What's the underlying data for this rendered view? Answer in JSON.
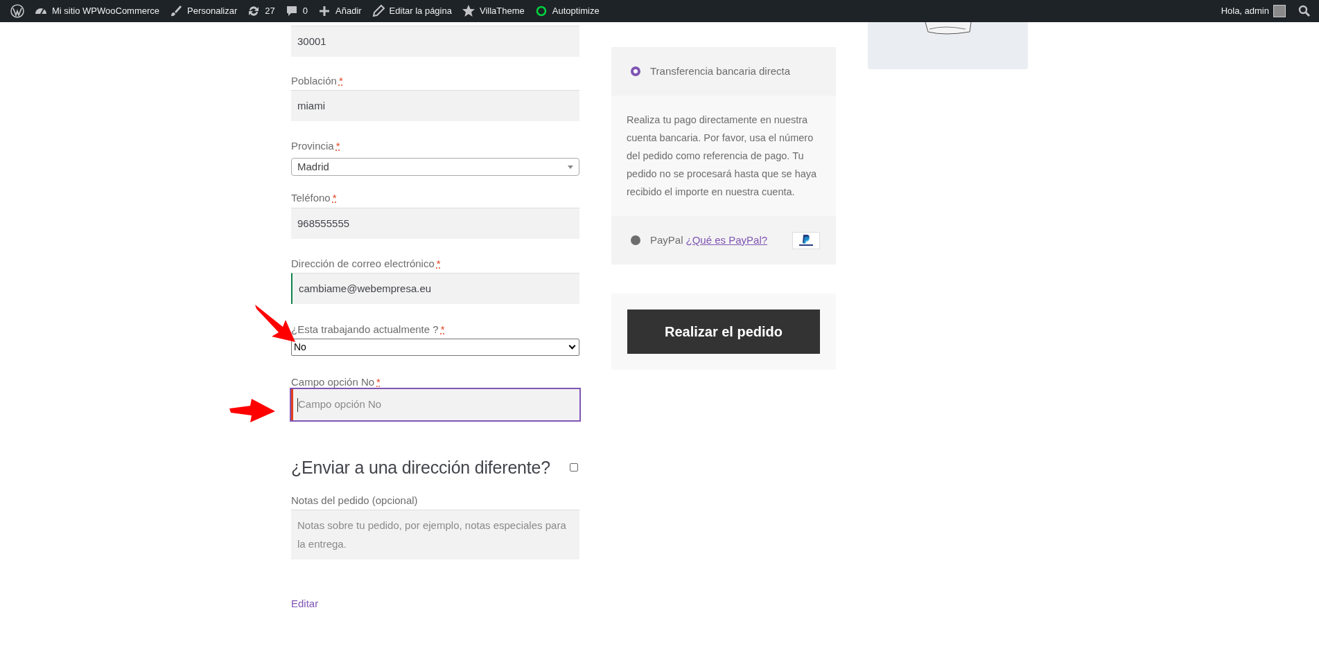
{
  "admin_bar": {
    "items": [
      {
        "kind": "wp"
      },
      {
        "kind": "site",
        "label": "Mi sitio WPWooCommerce"
      },
      {
        "kind": "customize",
        "label": "Personalizar"
      },
      {
        "kind": "updates",
        "label": "27"
      },
      {
        "kind": "comments",
        "label": "0"
      },
      {
        "kind": "new",
        "label": "Añadir"
      },
      {
        "kind": "edit",
        "label": "Editar la página"
      },
      {
        "kind": "theme",
        "label": "VillaTheme"
      },
      {
        "kind": "status",
        "label": "Autoptimize"
      }
    ],
    "greeting": "Hola, admin"
  },
  "form": {
    "fields": [
      {
        "kind": "text",
        "value": "30001",
        "valid": false,
        "invalid": false,
        "focused": false
      },
      {
        "kind": "text",
        "label": "Población",
        "required_mark": "*",
        "value": "miami",
        "valid": false,
        "invalid": false,
        "focused": false
      },
      {
        "kind": "select",
        "label": "Provincia",
        "required_mark": "*",
        "value": "Madrid",
        "valid": false,
        "invalid": false,
        "focused": false
      },
      {
        "kind": "text",
        "label": "Teléfono",
        "required_mark": "*",
        "value": "968555555",
        "valid": false,
        "invalid": false,
        "focused": false
      },
      {
        "kind": "text",
        "label": "Dirección de correo electrónico",
        "required_mark": "*",
        "value": "cambiame@webempresa.eu",
        "valid": true,
        "invalid": false,
        "focused": false
      },
      {
        "kind": "native-select",
        "label": "¿Esta trabajando actualmente ?",
        "required_mark": "*",
        "value": "No",
        "valid": false,
        "invalid": false,
        "focused": false
      },
      {
        "kind": "text",
        "label": "Campo opción No",
        "required_mark": "*",
        "placeholder": "Campo opción No",
        "valid": false,
        "invalid": true,
        "focused": true
      }
    ],
    "ship_different": {
      "title": "¿Enviar a una dirección diferente?",
      "checked": false
    },
    "notes": {
      "label": "Notas del pedido (opcional)",
      "placeholder": "Notas sobre tu pedido, por ejemplo, notas especiales para la entrega."
    },
    "edit_link": "Editar"
  },
  "payment": {
    "methods": [
      {
        "label": "Transferencia bancaria directa",
        "selected": true,
        "description": "Realiza tu pago directamente en nuestra cuenta bancaria. Por favor, usa el número del pedido como referencia de pago. Tu pedido no se procesará hasta que se haya recibido el importe en nuestra cuenta."
      },
      {
        "label": "PayPal",
        "selected": false,
        "link": "¿Qué es PayPal?",
        "logo": true
      }
    ],
    "place_order": "Realizar el pedido"
  }
}
